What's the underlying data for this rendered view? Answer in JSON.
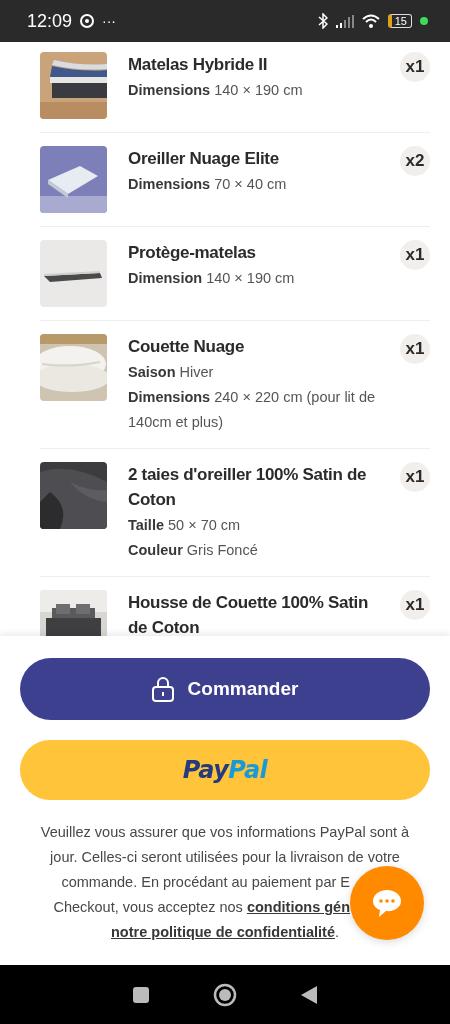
{
  "status_bar": {
    "time": "12:09",
    "overflow": "···",
    "battery": "15"
  },
  "items": [
    {
      "title": "Matelas Hybride II",
      "quantity": "x1",
      "attributes": [
        "**Dimensions** 140 × 190 cm"
      ]
    },
    {
      "title": "Oreiller Nuage Elite",
      "quantity": "x2",
      "attributes": [
        "**Dimensions** 70 × 40 cm"
      ]
    },
    {
      "title": "Protège-matelas",
      "quantity": "x1",
      "attributes": [
        "**Dimension** 140 × 190 cm"
      ]
    },
    {
      "title": "Couette Nuage",
      "quantity": "x1",
      "attributes": [
        "**Saison** Hiver",
        "**Dimensions** 240 × 220 cm (pour lit de 140cm et plus)"
      ]
    },
    {
      "title": "2 taies d'oreiller 100% Satin de Coton",
      "quantity": "x1",
      "attributes": [
        "**Taille** 50 × 70 cm",
        "**Couleur** Gris Foncé"
      ]
    },
    {
      "title": "Housse de Couette 100% Satin de Coton",
      "quantity": "x1"
    }
  ],
  "checkout": {
    "order_button": "Commander",
    "paypal_logo": [
      "Pay",
      "Pal"
    ],
    "notice_lines": [
      {
        "cut": false,
        "parts": [
          {
            "kind": "text",
            "text": "Veuillez vous assurer que vos informations PayPal sont à"
          }
        ]
      },
      {
        "cut": false,
        "parts": [
          {
            "kind": "text",
            "text": "jour. Celles-ci seront utilisées pour la livraison de votre"
          }
        ]
      },
      {
        "cut": true,
        "parts": [
          {
            "kind": "text",
            "text": "commande. En procédant au paiement par E"
          }
        ]
      },
      {
        "cut": true,
        "parts": [
          {
            "kind": "text",
            "text": "Checkout, vous acceptez nos "
          },
          {
            "kind": "link",
            "text": "conditions gén"
          }
        ]
      },
      {
        "cut": false,
        "parts": [
          {
            "kind": "link",
            "text": "notre politique de confidentialité"
          },
          {
            "kind": "text",
            "text": "."
          }
        ]
      }
    ]
  }
}
